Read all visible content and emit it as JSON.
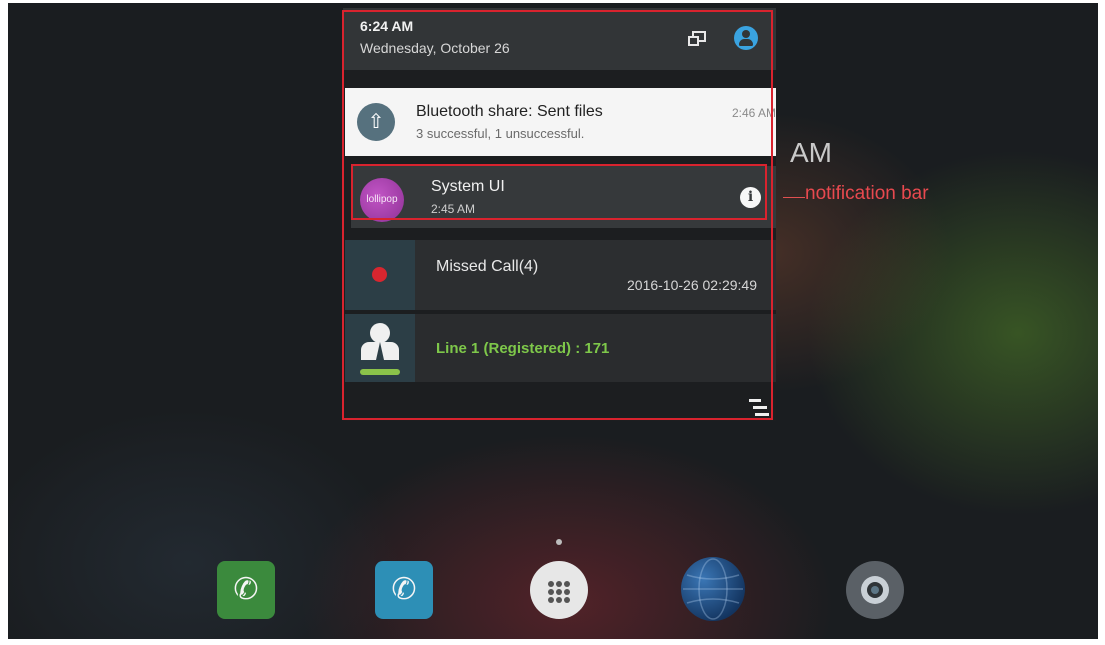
{
  "status_panel": {
    "time": "6:24 AM",
    "date": "Wednesday, October 26"
  },
  "background": {
    "clock_suffix": "AM"
  },
  "notifications": [
    {
      "id": "bluetooth",
      "icon": "upload-icon",
      "title": "Bluetooth share: Sent files",
      "subtitle": "3 successful, 1 unsuccessful.",
      "time": "2:46 AM"
    },
    {
      "id": "system-ui",
      "icon": "lollipop-icon",
      "badge_text": "lollipop",
      "title": "System UI",
      "time": "2:45 AM"
    },
    {
      "id": "missed-call",
      "icon": "missed-call-icon",
      "title": "Missed Call(4)",
      "datetime": "2016-10-26 02:29:49"
    },
    {
      "id": "line-status",
      "icon": "user-icon",
      "title": "Line 1 (Registered) : 171"
    }
  ],
  "annotation": {
    "label": "notification bar",
    "color": "#e8494f"
  },
  "dock": [
    {
      "name": "phone",
      "icon": "phone-icon",
      "color": "#3b8a3d"
    },
    {
      "name": "call-log",
      "icon": "call-log-icon",
      "color": "#2d8fb6"
    },
    {
      "name": "apps",
      "icon": "apps-grid-icon",
      "color": "#e7e7e7"
    },
    {
      "name": "browser",
      "icon": "globe-icon",
      "color": "#2a5a94"
    },
    {
      "name": "camera",
      "icon": "camera-icon",
      "color": "#5a6066"
    }
  ],
  "colors": {
    "accent_blue": "#3aa3e0",
    "line_green": "#7ec84a",
    "highlight_red": "#d9232e"
  }
}
